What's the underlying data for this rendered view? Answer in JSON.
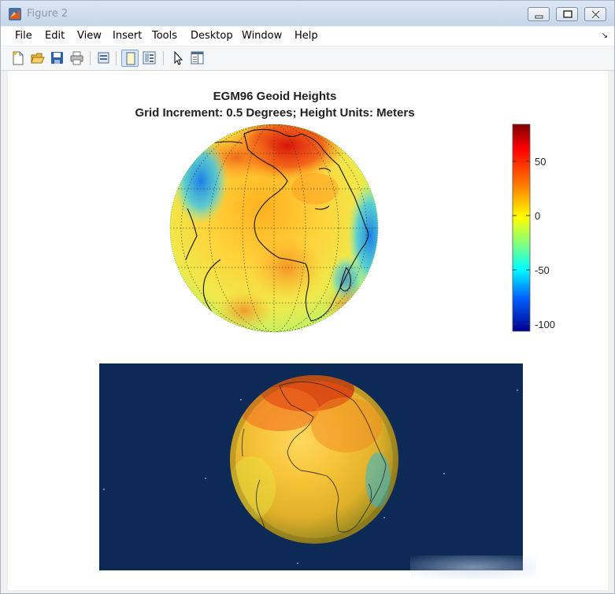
{
  "window": {
    "title": "Figure 2",
    "app_icon": "matlab-icon",
    "controls": [
      "minimize-icon",
      "restore-icon",
      "close-icon"
    ]
  },
  "menu": {
    "items": [
      "File",
      "Edit",
      "View",
      "Insert",
      "Tools",
      "Desktop",
      "Window",
      "Help"
    ]
  },
  "toolbar": {
    "buttons": [
      "new-figure-icon",
      "open-file-icon",
      "save-icon",
      "print-icon",
      "link-plot-icon",
      "hide-plot-tools-icon",
      "show-plot-tools-icon",
      "edit-plot-arrow-icon",
      "open-property-inspector-icon"
    ]
  },
  "figure": {
    "title_line1": "EGM96 Geoid Heights",
    "title_line2": "Grid Increment: 0.5 Degrees; Height Units: Meters",
    "colorbar": {
      "ticks": [
        "50",
        "0",
        "-50",
        "-100"
      ],
      "colormap": "jet"
    },
    "background_color": "#0d2a56"
  }
}
